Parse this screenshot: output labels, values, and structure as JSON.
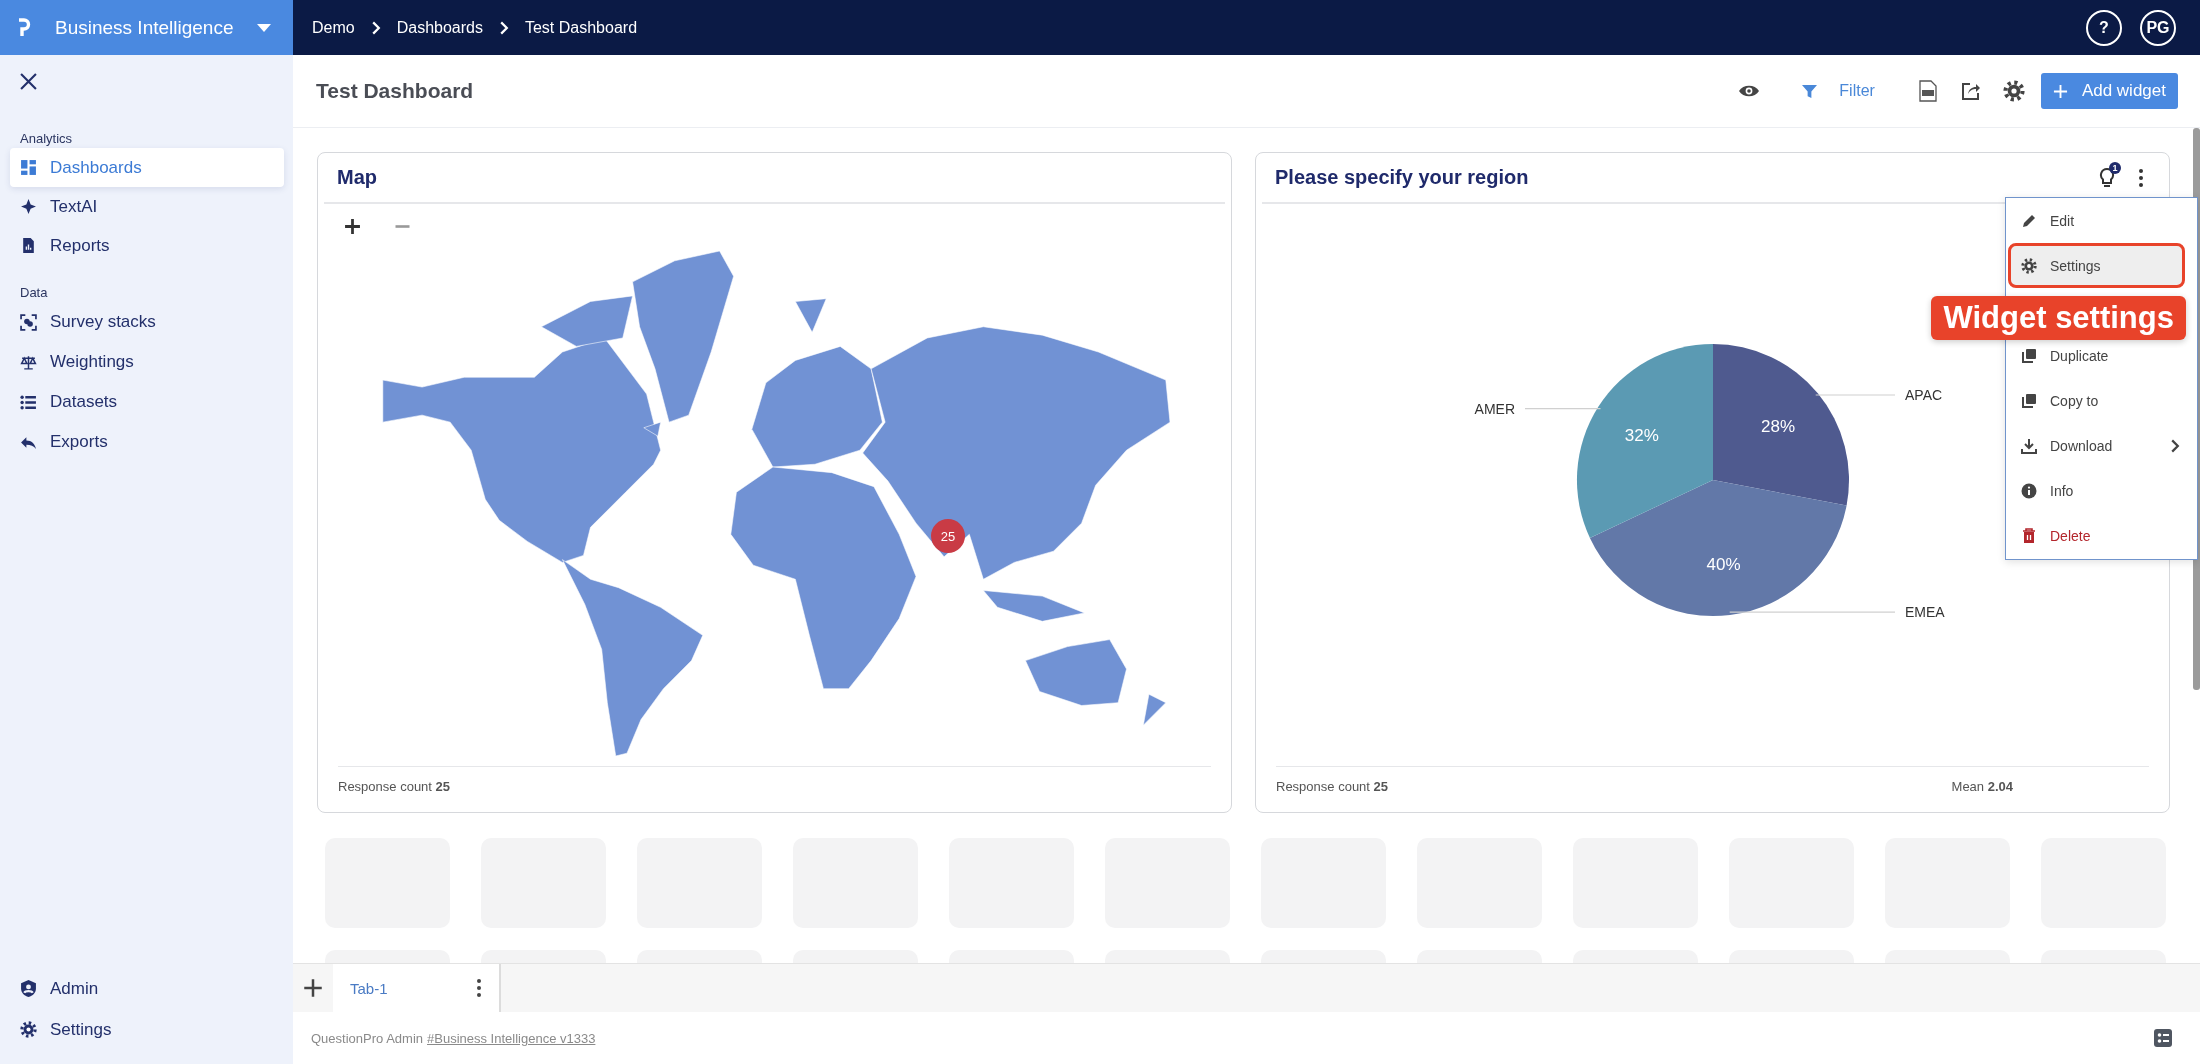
{
  "app": {
    "name": "Business Intelligence"
  },
  "breadcrumbs": [
    {
      "label": "Demo"
    },
    {
      "label": "Dashboards"
    },
    {
      "label": "Test Dashboard"
    }
  ],
  "help": "?",
  "user": {
    "initials": "PG"
  },
  "sidebar": {
    "sections": [
      {
        "title": "Analytics",
        "items": [
          {
            "label": "Dashboards",
            "selected": true
          },
          {
            "label": "TextAI",
            "selected": false
          },
          {
            "label": "Reports",
            "selected": false
          }
        ]
      },
      {
        "title": "Data",
        "items": [
          {
            "label": "Survey stacks",
            "selected": false
          },
          {
            "label": "Weightings",
            "selected": false
          },
          {
            "label": "Datasets",
            "selected": false
          },
          {
            "label": "Exports",
            "selected": false
          }
        ]
      }
    ],
    "bottom_items": [
      {
        "label": "Admin",
        "selected": false
      },
      {
        "label": "Settings",
        "selected": false
      }
    ]
  },
  "header": {
    "title": "Test Dashboard",
    "filter_label": "Filter",
    "add_button": "Add widget"
  },
  "widgets": [
    {
      "kind": "map",
      "title": "Map",
      "marker": "25",
      "footer_left": "Response count **25**"
    },
    {
      "kind": "pie",
      "title": "Please specify your region",
      "hint_badge": "1",
      "footer_left": "Response count **25**",
      "footer_right": "Mean **2.04**",
      "chart_data": {
        "type": "pie",
        "categories": [
          "APAC",
          "EMEA",
          "AMER"
        ],
        "values": [
          28,
          40,
          32
        ],
        "value_labels": [
          "28%",
          "40%",
          "32%"
        ]
      }
    }
  ],
  "widget_menu": {
    "items": [
      {
        "kind": "edit",
        "label": "Edit",
        "highlighted": false,
        "has_submenu": false
      },
      {
        "kind": "settings",
        "label": "Settings",
        "highlighted": true,
        "has_submenu": false
      },
      {
        "kind": "hidden"
      },
      {
        "kind": "duplicate",
        "label": "Duplicate",
        "highlighted": false,
        "has_submenu": false
      },
      {
        "kind": "copy",
        "label": "Copy to",
        "highlighted": false,
        "has_submenu": false
      },
      {
        "kind": "download",
        "label": "Download",
        "highlighted": false,
        "has_submenu": true
      },
      {
        "kind": "info",
        "label": "Info",
        "highlighted": false,
        "has_submenu": false
      },
      {
        "kind": "delete",
        "label": "Delete",
        "highlighted": false,
        "has_submenu": false
      }
    ]
  },
  "callout": "Widget settings",
  "tabs": [
    {
      "label": "Tab-1",
      "selected": true
    }
  ],
  "footer": {
    "text": "QuestionPro Admin",
    "link": "#Business Intelligence v1333"
  }
}
